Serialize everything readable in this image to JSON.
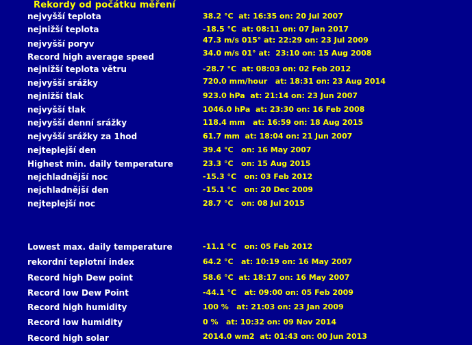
{
  "title": "Rekordy od počátku měření",
  "records": [
    {
      "label": "nejvyšší teplota",
      "value": "38.2 °C  at: 16:35 on: 20 Jul 2007"
    },
    {
      "label": "nejnižší teplota",
      "value": "-18.5 °C  at: 08:11 on: 07 Jan 2017"
    },
    {
      "label": "nejvyšší poryv",
      "value": "47.3 m/s 015° at: 22:29 on: 23 Jul 2009"
    },
    {
      "label": "Record high average speed",
      "value": "34.0 m/s 01° at:  23:10 on: 15 Aug 2008"
    },
    {
      "label": "nejnižší teplota větru",
      "value": "-28.7 °C  at: 08:03 on: 02 Feb 2012"
    },
    {
      "label": "nejvyšší srážky",
      "value": "720.0 mm/hour   at: 18:31 on: 23 Aug 2014"
    },
    {
      "label": "nejnižší tlak",
      "value": "923.0 hPa  at: 21:14 on: 23 Jun 2007"
    },
    {
      "label": "nejvyšší tlak",
      "value": "1046.0 hPa  at: 23:30 on: 16 Feb 2008"
    },
    {
      "label": "nejvyšší denní srážky",
      "value": "118.4 mm   at: 16:59 on: 18 Aug 2015"
    },
    {
      "label": "nejvyšší srážky za 1hod",
      "value": "61.7 mm  at: 18:04 on: 21 Jun 2007"
    },
    {
      "label": "nejteplejší den",
      "value": "39.4 °C   on: 16 May 2007"
    },
    {
      "label": "Highest min. daily temperature",
      "value": "23.3 °C   on: 15 Aug 2015"
    },
    {
      "label": "nejchladnější noc",
      "value": "-15.3 °C   on: 03 Feb 2012"
    },
    {
      "label": "nejchladnější den",
      "value": "-15.1 °C   on: 20 Dec 2009"
    },
    {
      "label": "nejteplejší noc",
      "value": "28.7 °C   on: 08 Jul 2015"
    },
    {
      "label": "Lowest max. daily temperature",
      "value": "-11.1 °C   on: 05 Feb 2012"
    },
    {
      "label": "rekordní teplotní index",
      "value": "64.2 °C   at: 10:19 on: 16 May 2007"
    },
    {
      "label": "Record high Dew point",
      "value": "58.6 °C  at: 18:17 on: 16 May 2007"
    },
    {
      "label": "Record low Dew Point",
      "value": "-44.1 °C   at: 09:00 on: 05 Feb 2009"
    },
    {
      "label": "Record high humidity",
      "value": "100 %   at: 21:03 on: 23 Jan 2009"
    },
    {
      "label": "Record low humidity",
      "value": "0 %   at: 10:32 on: 09 Nov 2014"
    },
    {
      "label": "Record high solar",
      "value": "2014.0 wm2  at: 01:43 on: 00 Jun 2013"
    }
  ]
}
